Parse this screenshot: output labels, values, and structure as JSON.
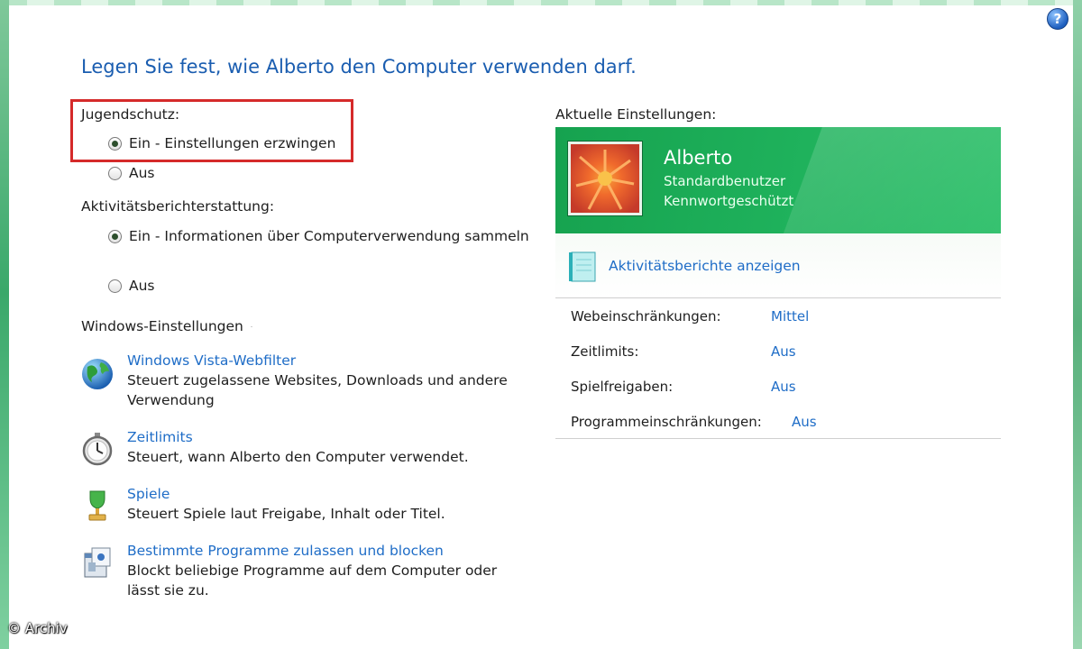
{
  "window": {
    "help_glyph": "?",
    "title": "Legen Sie fest, wie Alberto den Computer verwenden darf."
  },
  "jugendschutz": {
    "label": "Jugendschutz:",
    "options": [
      {
        "label": "Ein - Einstellungen erzwingen",
        "checked": true
      },
      {
        "label": "Aus",
        "checked": false
      }
    ]
  },
  "aktivitaet": {
    "label": "Aktivitätsberichterstattung:",
    "options": [
      {
        "label": "Ein - Informationen über Computerverwendung sammeln",
        "checked": true
      },
      {
        "label": "Aus",
        "checked": false
      }
    ]
  },
  "windows_settings": {
    "heading": "Windows-Einstellungen",
    "tasks": [
      {
        "icon": "globe-icon",
        "title": "Windows Vista-Webfilter",
        "desc": "Steuert zugelassene Websites, Downloads und andere Verwendung"
      },
      {
        "icon": "stopwatch-icon",
        "title": "Zeitlimits",
        "desc": "Steuert, wann Alberto den Computer verwendet."
      },
      {
        "icon": "trophy-icon",
        "title": "Spiele",
        "desc": "Steuert Spiele laut Freigabe, Inhalt oder Titel."
      },
      {
        "icon": "program-icon",
        "title": "Bestimmte Programme zulassen und blocken",
        "desc": "Blockt beliebige Programme auf dem Computer oder lässt sie zu."
      }
    ]
  },
  "current": {
    "label": "Aktuelle Einstellungen:",
    "user": {
      "name": "Alberto",
      "type": "Standardbenutzer",
      "password": "Kennwortgeschützt"
    },
    "reports_link": "Aktivitätsberichte anzeigen",
    "rows": [
      {
        "key": "Webeinschränkungen:",
        "value": "Mittel"
      },
      {
        "key": "Zeitlimits:",
        "value": "Aus"
      },
      {
        "key": "Spielfreigaben:",
        "value": "Aus"
      },
      {
        "key": "Programmeinschränkungen:",
        "value": "Aus"
      }
    ]
  },
  "copyright": "© Archiv",
  "colors": {
    "link": "#1f6dc7",
    "title": "#1a5db0",
    "card": "#1fb25c",
    "highlight": "#d52a2a"
  }
}
